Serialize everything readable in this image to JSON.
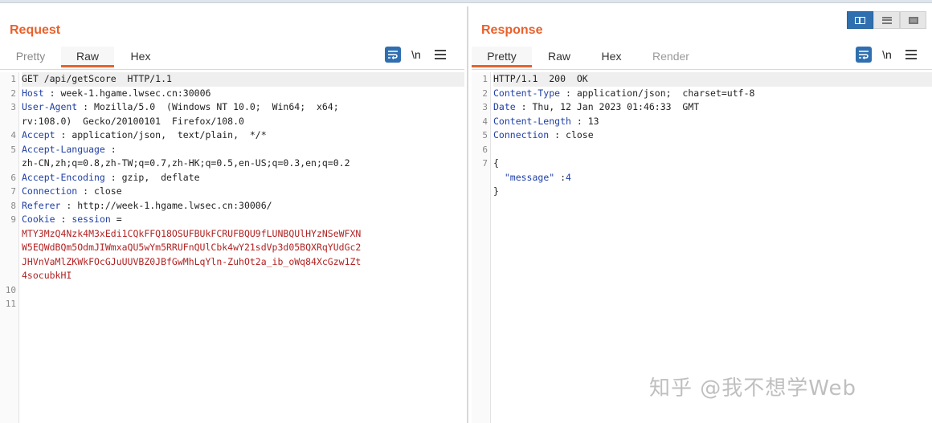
{
  "layout_toggle": {
    "options": [
      "side-by-side",
      "stacked",
      "single"
    ],
    "active": "side-by-side"
  },
  "request": {
    "title": "Request",
    "tabs": [
      {
        "label": "Pretty"
      },
      {
        "label": "Raw"
      },
      {
        "label": "Hex"
      }
    ],
    "active_tab": "Raw",
    "tools": {
      "wrap_icon": "wrap-lines-icon",
      "newline_label": "\\n",
      "menu_icon": "menu-icon"
    },
    "line_numbers": [
      "1",
      "2",
      "3",
      "4",
      "5",
      "6",
      "7",
      "8",
      "9",
      "10",
      "11"
    ],
    "lines": {
      "l1": "GET /api/getScore  HTTP/1.1",
      "l2_key": "Host",
      "l2_val": " : week-1.hgame.lwsec.cn:30006",
      "l3_key": "User-Agent",
      "l3_val": " : Mozilla/5.0  (Windows NT 10.0;  Win64;  x64;",
      "l3b": "rv:108.0)  Gecko/20100101  Firefox/108.0",
      "l4_key": "Accept",
      "l4_val": " : application/json,  text/plain,  */*",
      "l5_key": "Accept-Language",
      "l5_val": " :",
      "l5b": "zh-CN,zh;q=0.8,zh-TW;q=0.7,zh-HK;q=0.5,en-US;q=0.3,en;q=0.2",
      "l6_key": "Accept-Encoding",
      "l6_val": " : gzip,  deflate",
      "l7_key": "Connection",
      "l7_val": " : close",
      "l8_key": "Referer",
      "l8_val": " : http://week-1.hgame.lwsec.cn:30006/",
      "l9_key": "Cookie",
      "l9_sep": " : ",
      "l9_cookie": "session",
      "l9_eq": " =",
      "l9_v1": "MTY3MzQ4Nzk4M3xEdi1CQkFFQ18OSUFBUkFCRUFBQU9fLUNBQUlHYzNSeWFXN",
      "l9_v2": "W5EQWdBQm5OdmJIWmxaQU5wYm5RRUFnQUlCbk4wY21sdVp3d05BQXRqYUdGc2",
      "l9_v3": "JHVnVaMlZKWkFOcGJuUUVBZ0JBfGwMhLqYln-ZuhOt2a_ib_oWq84XcGzw1Zt",
      "l9_v4": "4socubkHI"
    }
  },
  "response": {
    "title": "Response",
    "tabs": [
      {
        "label": "Pretty"
      },
      {
        "label": "Raw"
      },
      {
        "label": "Hex"
      },
      {
        "label": "Render"
      }
    ],
    "active_tab": "Pretty",
    "tools": {
      "wrap_icon": "wrap-lines-icon",
      "newline_label": "\\n",
      "menu_icon": "menu-icon"
    },
    "line_numbers": [
      "1",
      "2",
      "3",
      "4",
      "5",
      "6",
      "7"
    ],
    "lines": {
      "l1": "HTTP/1.1  200  OK",
      "l2_key": "Content-Type",
      "l2_val": " : application/json;  charset=utf-8",
      "l3_key": "Date",
      "l3_val": " : Thu, 12 Jan 2023 01:46:33  GMT",
      "l4_key": "Content-Length",
      "l4_val": " : 13",
      "l5_key": "Connection",
      "l5_val": " : close",
      "l7_open": "{",
      "l8_key": "\"message\"",
      "l8_sep": " :",
      "l8_val": "4",
      "l9_close": "}"
    }
  },
  "watermark": "知乎 @我不想学Web",
  "colors": {
    "accent": "#e8612c",
    "header_key": "#1f3fa5",
    "cookie_value": "#b22222",
    "tool_blue": "#2f6fb0"
  }
}
